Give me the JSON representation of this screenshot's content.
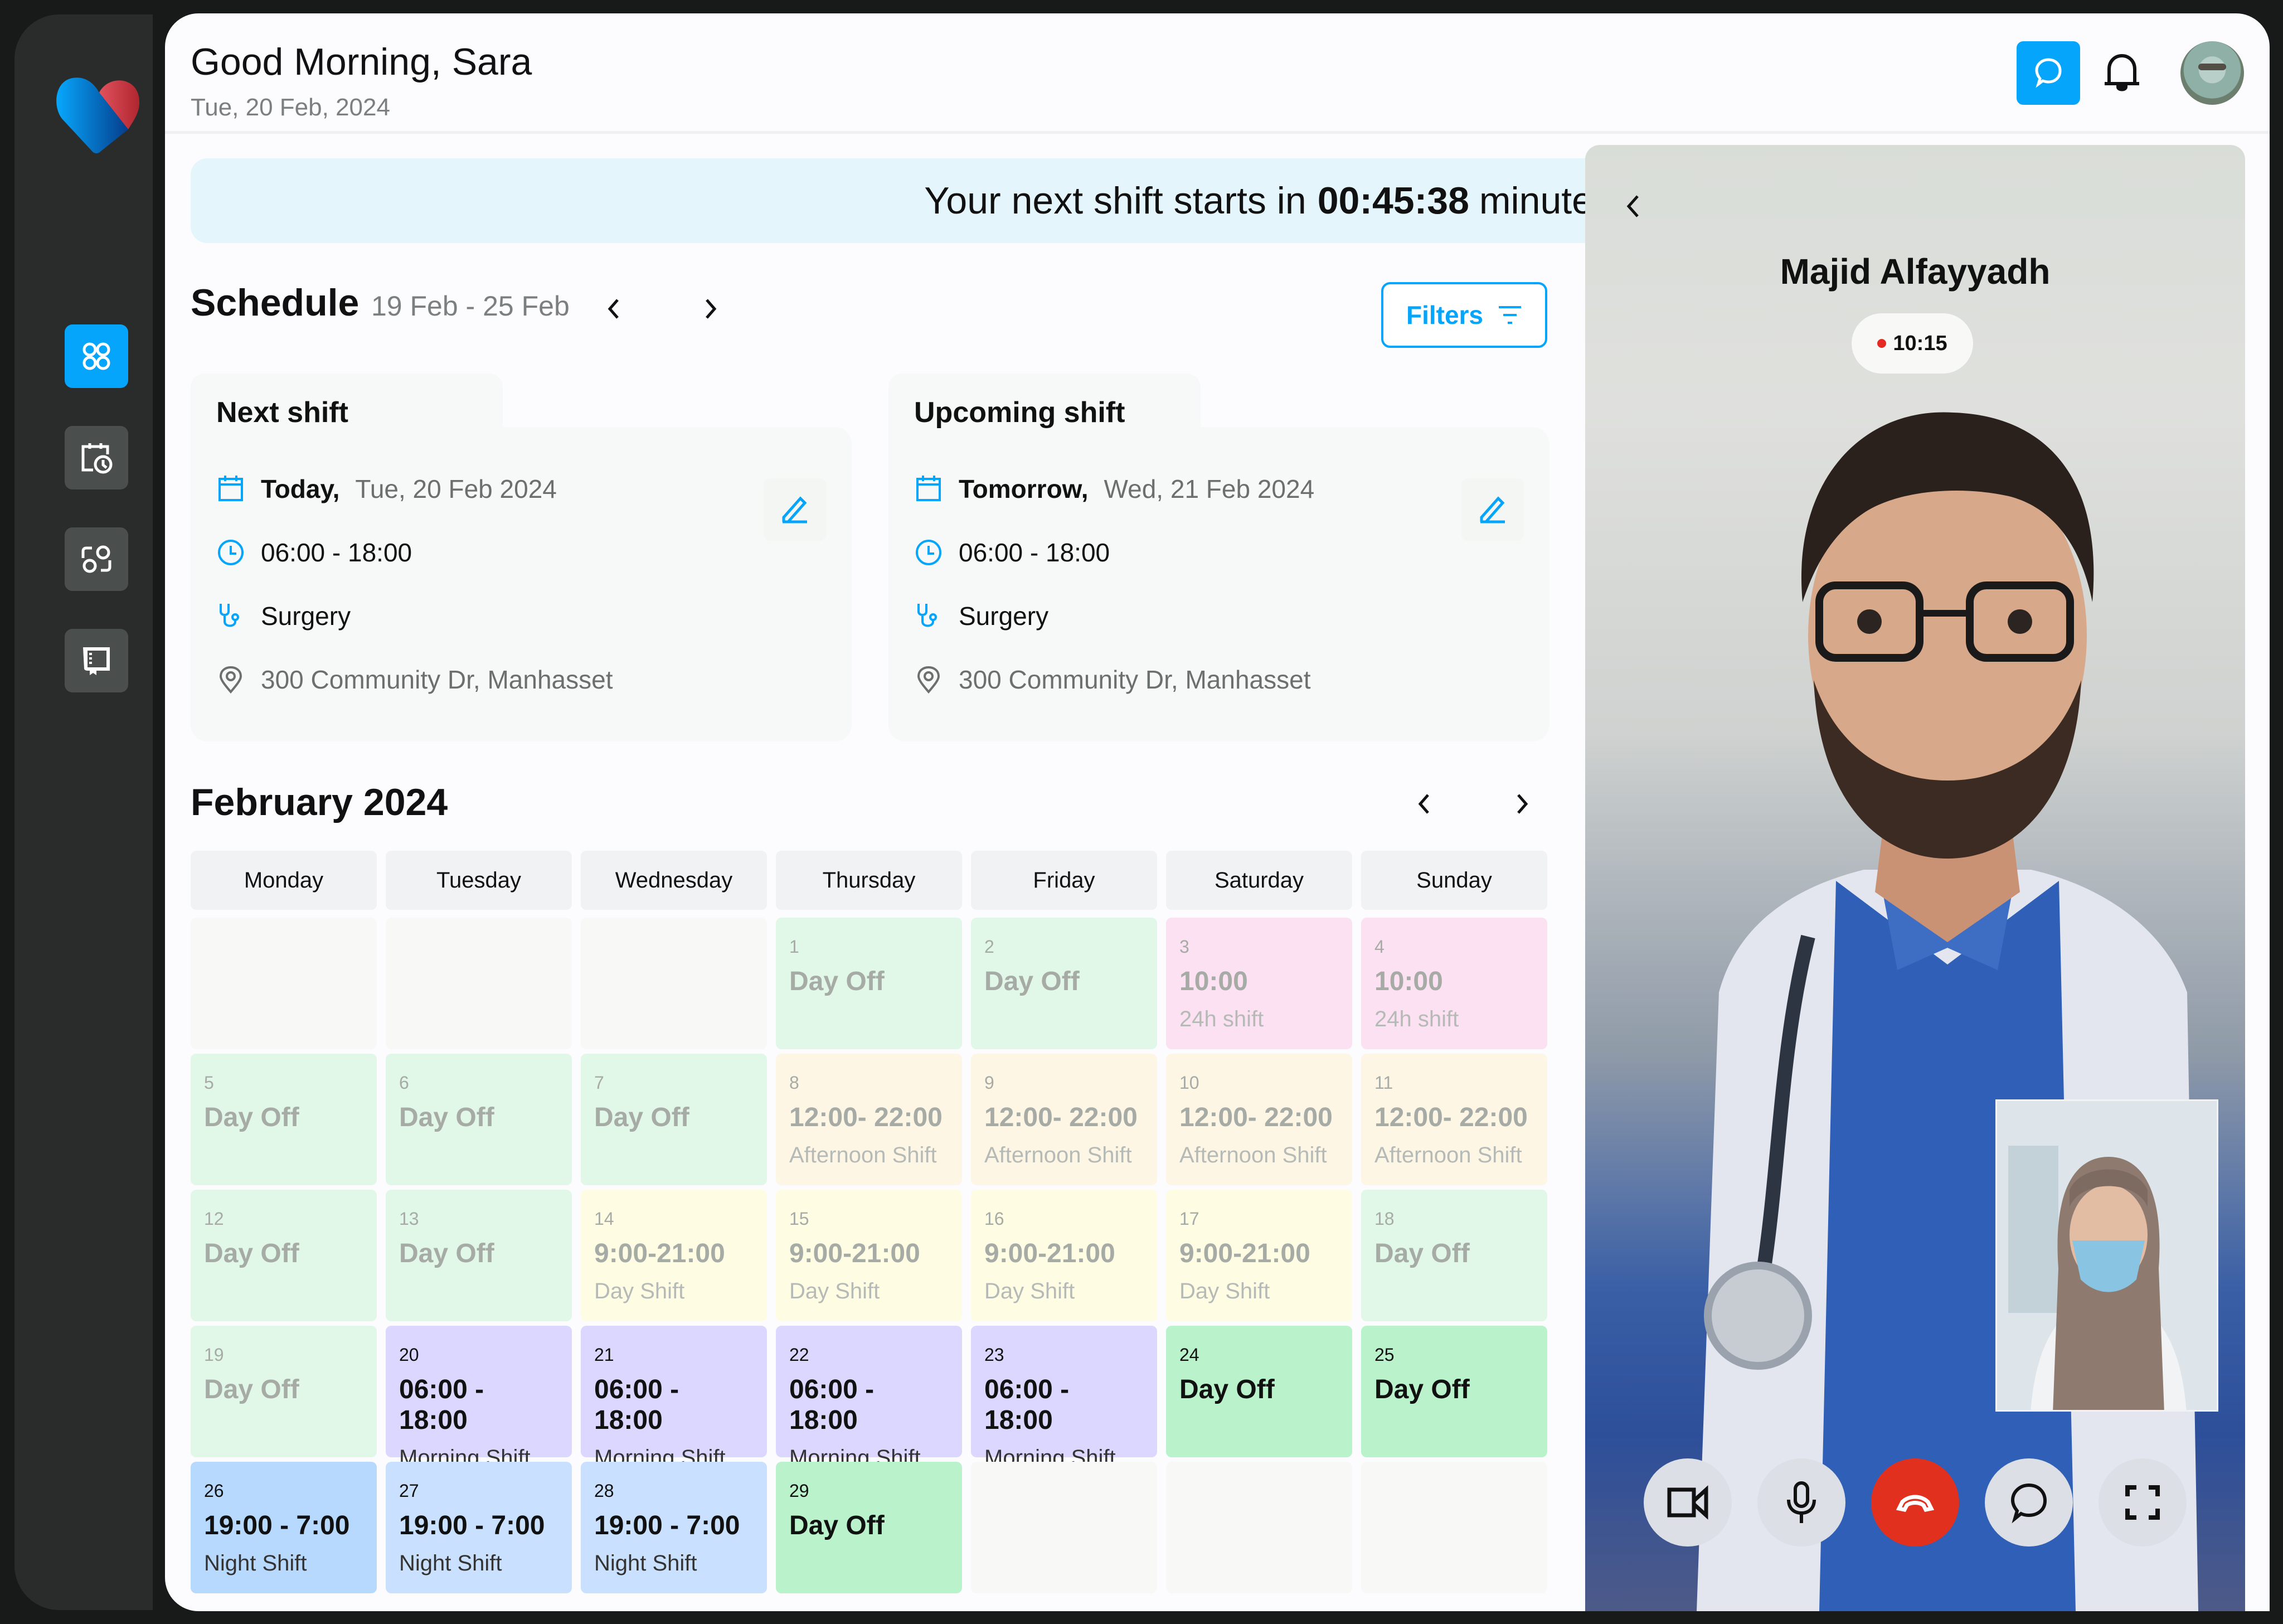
{
  "header": {
    "greeting": "Good Morning, Sara",
    "date": "Tue, 20 Feb, 2024"
  },
  "sidebar": {
    "items": [
      {
        "name": "dashboard",
        "icon": "grid-icon",
        "active": true
      },
      {
        "name": "schedule",
        "icon": "calendar-clock-icon",
        "active": false
      },
      {
        "name": "shifts",
        "icon": "swap-icon",
        "active": false
      },
      {
        "name": "handbook",
        "icon": "book-icon",
        "active": false
      }
    ]
  },
  "banner": {
    "prefix": "Your next shift starts in",
    "countdown": "00:45:38",
    "unit": "minutes"
  },
  "schedule": {
    "title": "Schedule",
    "range": "19 Feb - 25 Feb",
    "filters_label": "Filters"
  },
  "next_shift": {
    "title": "Next shift",
    "day_label": "Today,",
    "date": "Tue, 20 Feb 2024",
    "time": "06:00 - 18:00",
    "department": "Surgery",
    "location": "300 Community Dr, Manhasset"
  },
  "upcoming_shift": {
    "title": "Upcoming shift",
    "day_label": "Tomorrow,",
    "date": "Wed, 21 Feb 2024",
    "time": "06:00 - 18:00",
    "department": "Surgery",
    "location": "300 Community Dr, Manhasset"
  },
  "calendar": {
    "month": "February 2024",
    "weekdays": [
      "Monday",
      "Tuesday",
      "Wednesday",
      "Thursday",
      "Friday",
      "Saturday",
      "Sunday"
    ],
    "weeks": [
      [
        {
          "type": "empty"
        },
        {
          "type": "empty"
        },
        {
          "type": "empty"
        },
        {
          "day": "1",
          "main": "Day Off",
          "sub": "",
          "type": "off-faded",
          "state": "faded"
        },
        {
          "day": "2",
          "main": "Day Off",
          "sub": "",
          "type": "off-faded",
          "state": "faded"
        },
        {
          "day": "3",
          "main": "10:00",
          "sub": "24h shift",
          "type": "24",
          "state": "faded"
        },
        {
          "day": "4",
          "main": "10:00",
          "sub": "24h shift",
          "type": "24",
          "state": "faded"
        }
      ],
      [
        {
          "day": "5",
          "main": "Day Off",
          "sub": "",
          "type": "off-faded",
          "state": "faded"
        },
        {
          "day": "6",
          "main": "Day Off",
          "sub": "",
          "type": "off-faded",
          "state": "faded"
        },
        {
          "day": "7",
          "main": "Day Off",
          "sub": "",
          "type": "off-faded",
          "state": "faded"
        },
        {
          "day": "8",
          "main": "12:00- 22:00",
          "sub": "Afternoon Shift",
          "type": "afternoon",
          "state": "faded"
        },
        {
          "day": "9",
          "main": "12:00- 22:00",
          "sub": "Afternoon Shift",
          "type": "afternoon",
          "state": "faded"
        },
        {
          "day": "10",
          "main": "12:00- 22:00",
          "sub": "Afternoon Shift",
          "type": "afternoon",
          "state": "faded"
        },
        {
          "day": "11",
          "main": "12:00- 22:00",
          "sub": "Afternoon Shift",
          "type": "afternoon",
          "state": "faded"
        }
      ],
      [
        {
          "day": "12",
          "main": "Day Off",
          "sub": "",
          "type": "off-faded",
          "state": "faded"
        },
        {
          "day": "13",
          "main": "Day Off",
          "sub": "",
          "type": "off-faded",
          "state": "faded"
        },
        {
          "day": "14",
          "main": "9:00-21:00",
          "sub": "Day Shift",
          "type": "day",
          "state": "faded"
        },
        {
          "day": "15",
          "main": "9:00-21:00",
          "sub": "Day Shift",
          "type": "day",
          "state": "faded"
        },
        {
          "day": "16",
          "main": "9:00-21:00",
          "sub": "Day Shift",
          "type": "day",
          "state": "faded"
        },
        {
          "day": "17",
          "main": "9:00-21:00",
          "sub": "Day Shift",
          "type": "day",
          "state": "faded"
        },
        {
          "day": "18",
          "main": "Day Off",
          "sub": "",
          "type": "off-faded",
          "state": "faded"
        }
      ],
      [
        {
          "day": "19",
          "main": "Day Off",
          "sub": "",
          "type": "off-faded",
          "state": "faded"
        },
        {
          "day": "20",
          "main": "06:00 - 18:00",
          "sub": "Morning Shift",
          "type": "morning",
          "state": "active"
        },
        {
          "day": "21",
          "main": "06:00 - 18:00",
          "sub": "Morning Shift",
          "type": "morning",
          "state": "active"
        },
        {
          "day": "22",
          "main": "06:00 - 18:00",
          "sub": "Morning Shift",
          "type": "morning",
          "state": "active"
        },
        {
          "day": "23",
          "main": "06:00 - 18:00",
          "sub": "Morning Shift",
          "type": "morning",
          "state": "active"
        },
        {
          "day": "24",
          "main": "Day Off",
          "sub": "",
          "type": "off-active",
          "state": "active"
        },
        {
          "day": "25",
          "main": "Day Off",
          "sub": "",
          "type": "off-active",
          "state": "active"
        }
      ],
      [
        {
          "day": "26",
          "main": "19:00 - 7:00",
          "sub": "Night Shift",
          "type": "night-dark",
          "state": "active"
        },
        {
          "day": "27",
          "main": "19:00 - 7:00",
          "sub": "Night Shift",
          "type": "night",
          "state": "active"
        },
        {
          "day": "28",
          "main": "19:00 - 7:00",
          "sub": "Night Shift",
          "type": "night",
          "state": "active"
        },
        {
          "day": "29",
          "main": "Day Off",
          "sub": "",
          "type": "off-active",
          "state": "active"
        },
        {
          "type": "empty"
        },
        {
          "type": "empty"
        },
        {
          "type": "empty"
        }
      ]
    ]
  },
  "video_call": {
    "caller_name": "Majid Alfayyadh",
    "duration": "10:15",
    "recording_color": "#e32b22",
    "controls": [
      "video-camera-icon",
      "microphone-icon",
      "hang-up-icon",
      "chat-icon",
      "fullscreen-icon"
    ]
  },
  "colors": {
    "accent": "#05a5fb",
    "hangup": "#e2301f",
    "sidebar_bg": "#292c2b"
  }
}
